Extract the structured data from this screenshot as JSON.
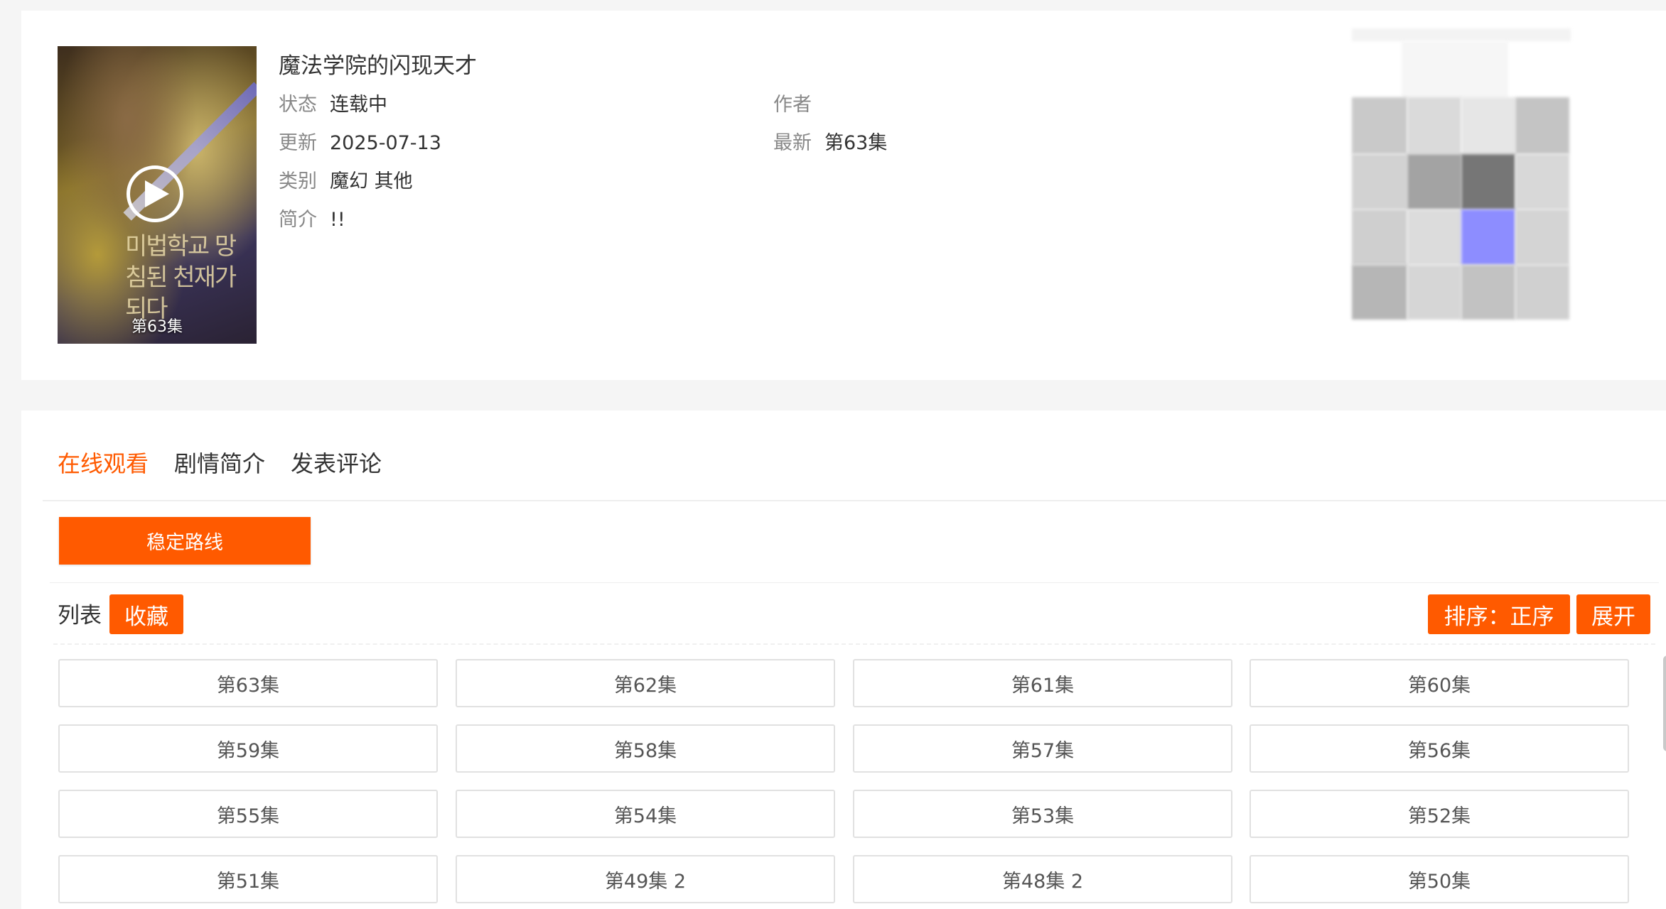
{
  "info": {
    "title": "魔法学院的闪现天才",
    "poster_episode": "第63集",
    "fields": {
      "status": {
        "label": "状态",
        "value": "连载中"
      },
      "author": {
        "label": "作者",
        "value": ""
      },
      "updated": {
        "label": "更新",
        "value": "2025-07-13"
      },
      "latest": {
        "label": "最新",
        "value": "第63集"
      },
      "category": {
        "label": "类别",
        "value": "魔幻 其他"
      },
      "intro": {
        "label": "简介",
        "value": "!!"
      }
    },
    "poster_art_text": "미법학교 망침된 천재가 되다"
  },
  "tabs": [
    "在线观看",
    "剧情简介",
    "发表评论"
  ],
  "route_button": "稳定路线",
  "list": {
    "label": "列表",
    "favorite": "收藏",
    "sort": "排序：正序",
    "expand": "展开"
  },
  "episodes": [
    "第63集",
    "第62集",
    "第61集",
    "第60集",
    "第59集",
    "第58集",
    "第57集",
    "第56集",
    "第55集",
    "第54集",
    "第53集",
    "第52集",
    "第51集",
    "第49集 2",
    "第48集 2",
    "第50集"
  ],
  "colors": {
    "accent": "#ff5a00",
    "qr_highlight": "#8d8dff"
  }
}
